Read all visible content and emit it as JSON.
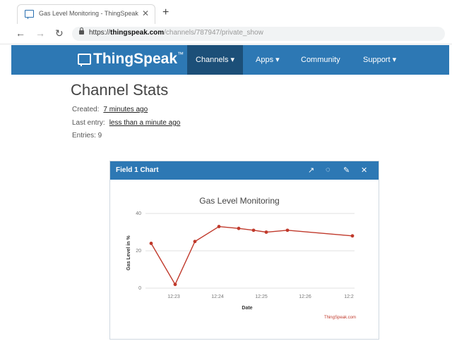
{
  "browser": {
    "tab_title": "Gas Level Monitoring - ThingSpeak",
    "url_scheme": "https://",
    "url_host": "thingspeak.com",
    "url_path": "/channels/787947/private_show",
    "back_icon": "back-arrow-icon",
    "forward_icon": "forward-arrow-icon",
    "reload_icon": "reload-icon"
  },
  "nav": {
    "logo": "ThingSpeak",
    "logo_tm": "™",
    "items": [
      {
        "label": "Channels ▾"
      },
      {
        "label": "Apps ▾"
      },
      {
        "label": "Community"
      },
      {
        "label": "Support ▾"
      }
    ],
    "active_index": 0,
    "bg_color": "#2d78b4",
    "active_color": "#1c4f78"
  },
  "stats": {
    "title": "Channel Stats",
    "created_label": "Created:",
    "created_value": "7 minutes ago",
    "last_entry_label": "Last entry:",
    "last_entry_value": "less than a minute ago",
    "entries_label": "Entries: 9"
  },
  "widget": {
    "title": "Field 1 Chart",
    "icons": [
      "external-link-icon",
      "comment-icon",
      "edit-icon",
      "close-icon"
    ]
  },
  "chart_data": {
    "type": "line",
    "title": "Gas Level Monitoring",
    "xlabel": "Date",
    "ylabel": "Gas Level in %",
    "x_ticks": [
      "12:23",
      "12:24",
      "12:25",
      "12:26",
      "12:2"
    ],
    "y_ticks": [
      0,
      20,
      40
    ],
    "ylim": [
      0,
      40
    ],
    "series": [
      {
        "values": [
          24,
          2,
          25,
          33,
          32,
          31,
          30,
          31,
          28
        ],
        "color": "#c0392b"
      }
    ],
    "credit": "ThingSpeak.com",
    "grid": true
  }
}
